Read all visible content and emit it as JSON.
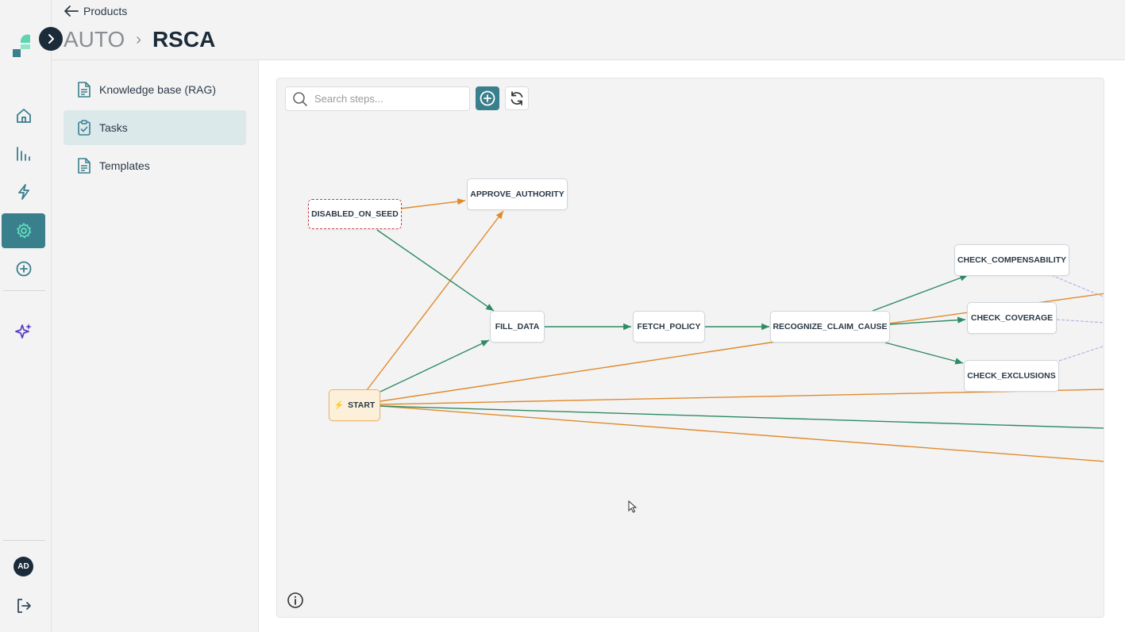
{
  "header": {
    "back_label": "Products",
    "breadcrumb_parent": "AUTO",
    "breadcrumb_current": "RSCA"
  },
  "rail": {
    "avatar_initials": "AD"
  },
  "subnav": {
    "items": [
      {
        "label": "Knowledge base (RAG)",
        "icon": "document-icon"
      },
      {
        "label": "Tasks",
        "icon": "clipboard-check-icon",
        "active": true
      },
      {
        "label": "Templates",
        "icon": "document-icon"
      }
    ]
  },
  "toolbar": {
    "search_placeholder": "Search steps..."
  },
  "graph": {
    "nodes": {
      "disabled_on_seed": "DISABLED_ON_SEED",
      "approve_authority": "APPROVE_AUTHORITY",
      "fill_data": "FILL_DATA",
      "fetch_policy": "FETCH_POLICY",
      "recognize_claim_cause": "RECOGNIZE_CLAIM_CAUSE",
      "check_compensability": "CHECK_COMPENSABILITY",
      "check_coverage": "CHECK_COVERAGE",
      "check_exclusions": "CHECK_EXCLUSIONS",
      "start": "START"
    },
    "colors": {
      "success_edge": "#2e8b63",
      "failure_edge": "#e08a2c",
      "other_edge": "#b9b2e6",
      "disabled_border": "#c0404f"
    }
  },
  "colors": {
    "accent": "#3a7f8c",
    "dark": "#1c2b39"
  }
}
